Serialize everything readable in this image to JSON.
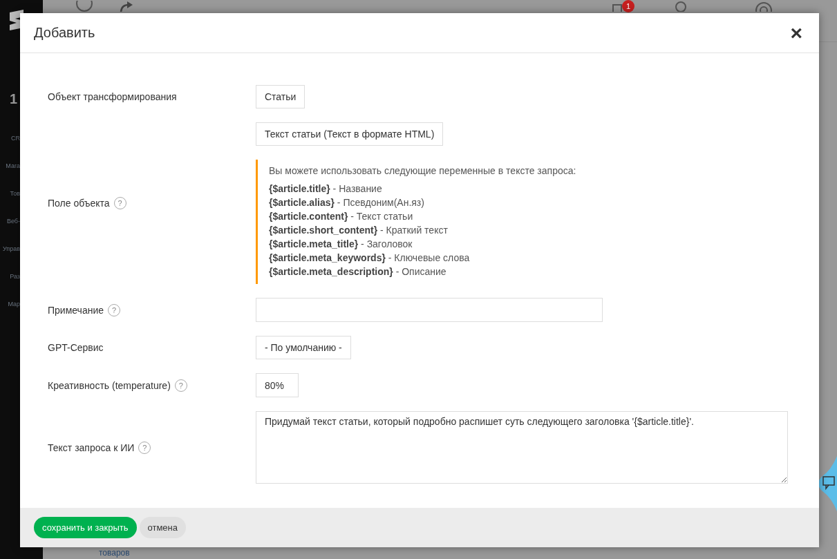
{
  "background": {
    "sidebar_counter": "1",
    "sidebar_items": [
      "CR",
      "Мага",
      "Тов",
      "Веб-",
      "Управ",
      "Раз",
      "Мар"
    ],
    "header_badge": "1",
    "footer_link": "товаров"
  },
  "dialog": {
    "title": "Добавить",
    "close": "×",
    "fields": [
      {
        "kind": "select",
        "label": "Объект трансформирования",
        "value": "Статьи"
      },
      {
        "kind": "select",
        "label": "Поле объекта",
        "help": "?",
        "value": "Текст статьи (Текст в формате HTML)",
        "hint": {
          "intro": "Вы можете использовать следующие переменные в тексте запроса:",
          "lines": [
            "**{$article.title}** - Название",
            "**{$article.alias}** - Псевдоним(Ан.яз)",
            "**{$article.content}** - Текст статьи",
            "**{$article.short_content}** - Краткий текст",
            "**{$article.meta_title}** - Заголовок",
            "**{$article.meta_keywords}** - Ключевые слова",
            "**{$article.meta_description}** - Описание"
          ]
        }
      },
      {
        "kind": "input",
        "label": "Примечание",
        "help": "?",
        "wide": true
      },
      {
        "kind": "select",
        "label": "GPT-Сервис",
        "value": "- По умолчанию -"
      },
      {
        "kind": "input",
        "label": "Креативность (temperature)",
        "help": "?",
        "value": "80%"
      },
      {
        "kind": "textarea",
        "label": "Текст запроса к ИИ",
        "help": "?",
        "value": "Придумай текст статьи, который подробно распишет суть следующего заголовка '{$article.title}'."
      }
    ],
    "buttons": [
      {
        "kind": "primary",
        "label": "сохранить и закрыть"
      },
      {
        "kind": "secondary",
        "label": "отмена"
      }
    ]
  }
}
